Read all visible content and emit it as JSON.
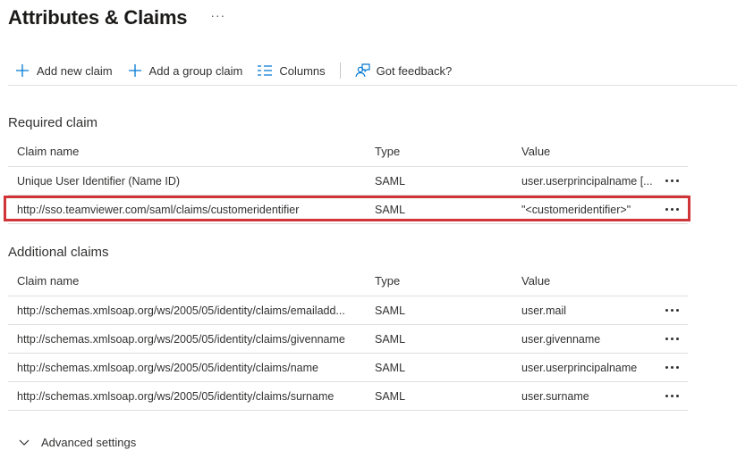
{
  "header": {
    "title": "Attributes & Claims",
    "more": "···"
  },
  "toolbar": {
    "add_new_claim": "Add new claim",
    "add_group_claim": "Add a group claim",
    "columns": "Columns",
    "feedback": "Got feedback?"
  },
  "required": {
    "title": "Required claim",
    "columns": {
      "name": "Claim name",
      "type": "Type",
      "value": "Value"
    },
    "rows": [
      {
        "name": "Unique User Identifier (Name ID)",
        "type": "SAML",
        "value": "user.userprincipalname [..."
      },
      {
        "name": "http://sso.teamviewer.com/saml/claims/customeridentifier",
        "type": "SAML",
        "value": "\"<customeridentifier>\""
      }
    ]
  },
  "additional": {
    "title": "Additional claims",
    "columns": {
      "name": "Claim name",
      "type": "Type",
      "value": "Value"
    },
    "rows": [
      {
        "name": "http://schemas.xmlsoap.org/ws/2005/05/identity/claims/emailadd...",
        "type": "SAML",
        "value": "user.mail"
      },
      {
        "name": "http://schemas.xmlsoap.org/ws/2005/05/identity/claims/givenname",
        "type": "SAML",
        "value": "user.givenname"
      },
      {
        "name": "http://schemas.xmlsoap.org/ws/2005/05/identity/claims/name",
        "type": "SAML",
        "value": "user.userprincipalname"
      },
      {
        "name": "http://schemas.xmlsoap.org/ws/2005/05/identity/claims/surname",
        "type": "SAML",
        "value": "user.surname"
      }
    ]
  },
  "advanced": {
    "label": "Advanced settings"
  },
  "colors": {
    "accent": "#0078d4",
    "highlight": "#d13438",
    "border": "#e1dfdd",
    "text": "#323130"
  }
}
